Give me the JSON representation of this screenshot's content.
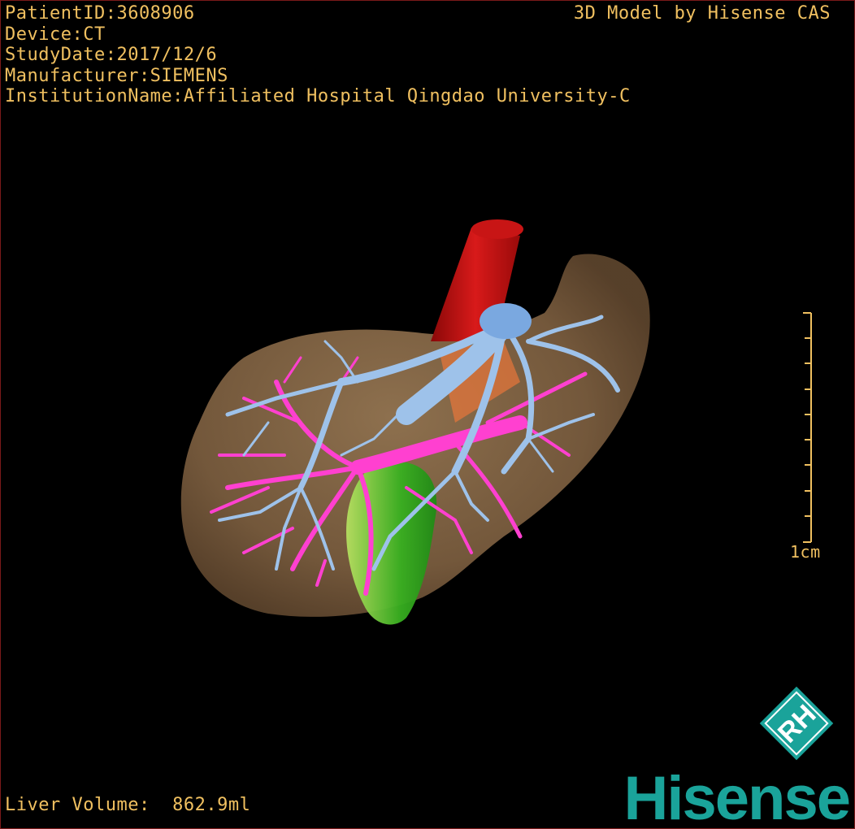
{
  "header": {
    "patient_id": "PatientID:3608906",
    "device": "Device:CT",
    "study_date": "StudyDate:2017/12/6",
    "manufacturer": "Manufacturer:SIEMENS",
    "institution": "InstitutionName:Affiliated Hospital Qingdao University-C",
    "model_credit": "3D Model by Hisense CAS"
  },
  "footer": {
    "liver_volume": "Liver Volume:  862.9ml"
  },
  "scale_bar": {
    "label": "1cm",
    "color": "#f0c060"
  },
  "logo": {
    "brand": "Hisense",
    "mark": "RH",
    "color": "#1aa39a"
  },
  "colors": {
    "overlay_text": "#f0c060",
    "liver": "#8a6a48",
    "portal_vein": "#9ec2ea",
    "hepatic_artery": "#ff40d0",
    "ivc": "#c01010",
    "gallbladder": "#40c020"
  }
}
